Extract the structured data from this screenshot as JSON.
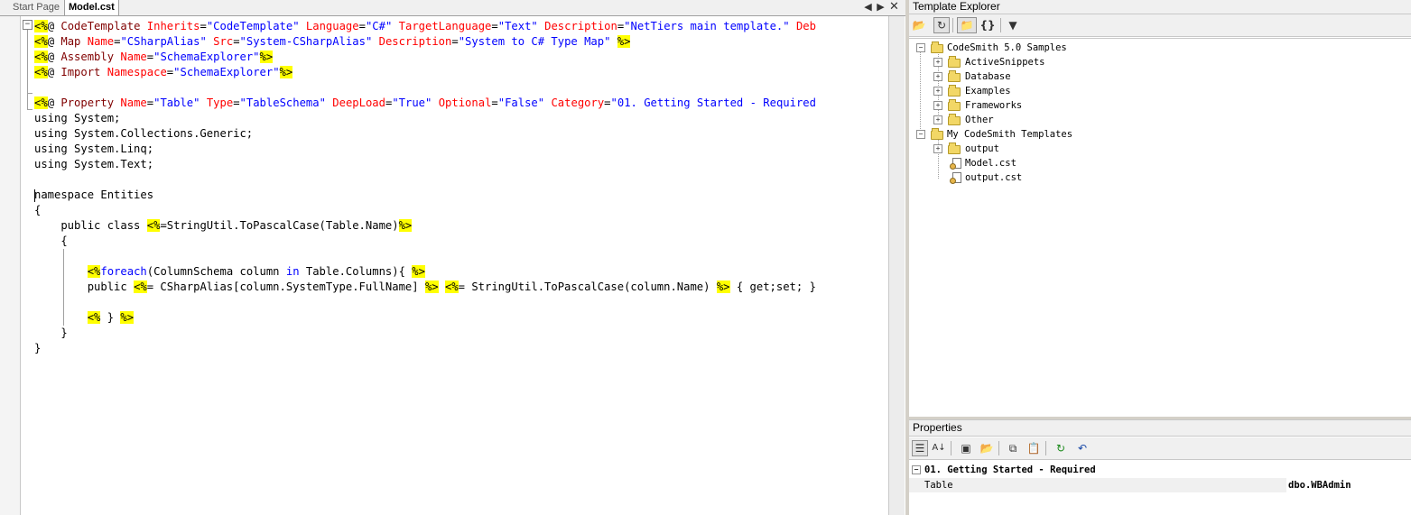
{
  "doc_tabs": {
    "start_page": "Start Page",
    "active": "Model.cst",
    "prev_icon": "chevron-left-icon",
    "next_icon": "chevron-right-icon",
    "close_icon": "close-icon"
  },
  "colors": {
    "directive_highlight": "#ffff00",
    "keyword": "#0000ff",
    "attribute": "#ff0000",
    "string": "#0000ff",
    "tag": "#800000"
  },
  "code": {
    "l1": {
      "open": "<%",
      "rest1": "@ ",
      "tag": "CodeTemplate",
      "a1": "Inherits",
      "v1": "\"CodeTemplate\"",
      "a2": "Language",
      "v2": "\"C#\"",
      "a3": "TargetLanguage",
      "v3": "\"Text\"",
      "a4": "Description",
      "v4": "\"NetTiers main template.\"",
      "a5": "Deb"
    },
    "l2": {
      "open": "<%",
      "rest1": "@ ",
      "tag": "Map",
      "a1": "Name",
      "v1": "\"CSharpAlias\"",
      "a2": "Src",
      "v2": "\"System-CSharpAlias\"",
      "a3": "Description",
      "v3": "\"System to C# Type Map\"",
      "close": "%>"
    },
    "l3": {
      "open": "<%",
      "rest1": "@ ",
      "tag": "Assembly",
      "a1": "Name",
      "v1": "\"SchemaExplorer\"",
      "close": "%>"
    },
    "l4": {
      "open": "<%",
      "rest1": "@ ",
      "tag": "Import",
      "a1": "Namespace",
      "v1": "\"SchemaExplorer\"",
      "close": "%>"
    },
    "l6": {
      "open": "<%",
      "rest1": "@ ",
      "tag": "Property",
      "a1": "Name",
      "v1": "\"Table\"",
      "a2": "Type",
      "v2": "\"TableSchema\"",
      "a3": "DeepLoad",
      "v3": "\"True\"",
      "a4": "Optional",
      "v4": "\"False\"",
      "a5": "Category",
      "v5": "\"01. Getting Started - Required"
    },
    "l7": "using System;",
    "l8": "using System.Collections.Generic;",
    "l9": "using System.Linq;",
    "l10": "using System.Text;",
    "l12": "namespace Entities",
    "l13": "{",
    "l14": {
      "pre": "    public class ",
      "open": "<%",
      "mid": "=StringUtil.ToPascalCase(Table.Name)",
      "close": "%>"
    },
    "l15": "    {",
    "l17": {
      "pre": "        ",
      "open": "<%",
      "kw1": "foreach",
      "mid1": "(ColumnSchema column ",
      "kw2": "in",
      "mid2": " Table.Columns){ ",
      "close": "%>"
    },
    "l18": {
      "pre": "        public ",
      "open1": "<%",
      "mid1": "= CSharpAlias[column.SystemType.FullName] ",
      "close1": "%>",
      "sp": " ",
      "open2": "<%",
      "mid2": "= StringUtil.ToPascalCase(column.Name) ",
      "close2": "%>",
      "tail": " { get;set; }"
    },
    "l20": {
      "pre": "        ",
      "open": "<%",
      "mid": " } ",
      "close": "%>"
    },
    "l21": "    }",
    "l22": "}"
  },
  "template_explorer": {
    "title": "Template Explorer",
    "toolbar_icons": [
      "open-folder-icon",
      "refresh-icon",
      "folder-view-icon",
      "braces-icon",
      "filter-icon"
    ],
    "braces_label": "{}",
    "tree": {
      "root1": "CodeSmith 5.0 Samples",
      "root1_children": [
        "ActiveSnippets",
        "Database",
        "Examples",
        "Frameworks",
        "Other"
      ],
      "root2": "My CodeSmith Templates",
      "root2_folder": "output",
      "root2_files": [
        "Model.cst",
        "output.cst"
      ]
    }
  },
  "properties": {
    "title": "Properties",
    "toolbar_icons": [
      "categorized-icon",
      "alphabetical-icon",
      "save-icon",
      "open-icon",
      "copy-icon",
      "paste-icon",
      "refresh-icon",
      "undo-icon"
    ],
    "category": "01. Getting Started - Required",
    "row_name": "Table",
    "row_value": "dbo.WBAdmin"
  }
}
